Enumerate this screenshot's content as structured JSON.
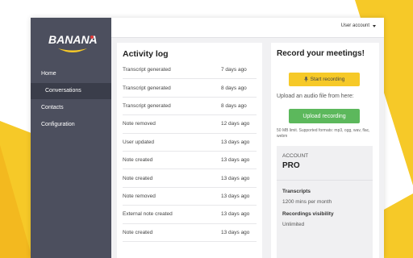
{
  "brand": {
    "logo_text": "BANANA",
    "accent": "#f6c928"
  },
  "header": {
    "user_account": "User account"
  },
  "sidebar": {
    "items": [
      {
        "label": "Home"
      },
      {
        "label": "Conversations"
      },
      {
        "label": "Contacts"
      },
      {
        "label": "Configuration"
      }
    ],
    "active": "Conversations"
  },
  "activity": {
    "title": "Activity log",
    "rows": [
      {
        "event": "Transcript generated",
        "when": "7 days ago"
      },
      {
        "event": "Transcript generated",
        "when": "8 days ago"
      },
      {
        "event": "Transcript generated",
        "when": "8 days ago"
      },
      {
        "event": "Note removed",
        "when": "12 days ago"
      },
      {
        "event": "User updated",
        "when": "13 days ago"
      },
      {
        "event": "Note created",
        "when": "13 days ago"
      },
      {
        "event": "Note created",
        "when": "13 days ago"
      },
      {
        "event": "Note removed",
        "when": "13 days ago"
      },
      {
        "event": "External note created",
        "when": "13 days ago"
      },
      {
        "event": "Note created",
        "when": "13 days ago"
      }
    ]
  },
  "record": {
    "title": "Record your meetings!",
    "start_label": "Start recording",
    "upload_text": "Upload an audio file from here:",
    "upload_label": "Upload recording",
    "limit_text": "50 MB limit. Supported formats: mp3, ogg, wav, flac, webm",
    "account_label": "ACCOUNT",
    "plan": "PRO",
    "transcripts_label": "Transcripts",
    "transcripts_value": "1200 mins per month",
    "visibility_label": "Recordings visibility",
    "visibility_value": "Unlimited"
  },
  "colors": {
    "yellow": "#f6c928",
    "sidebar": "#4c4f5e",
    "green": "#5cb85c"
  }
}
